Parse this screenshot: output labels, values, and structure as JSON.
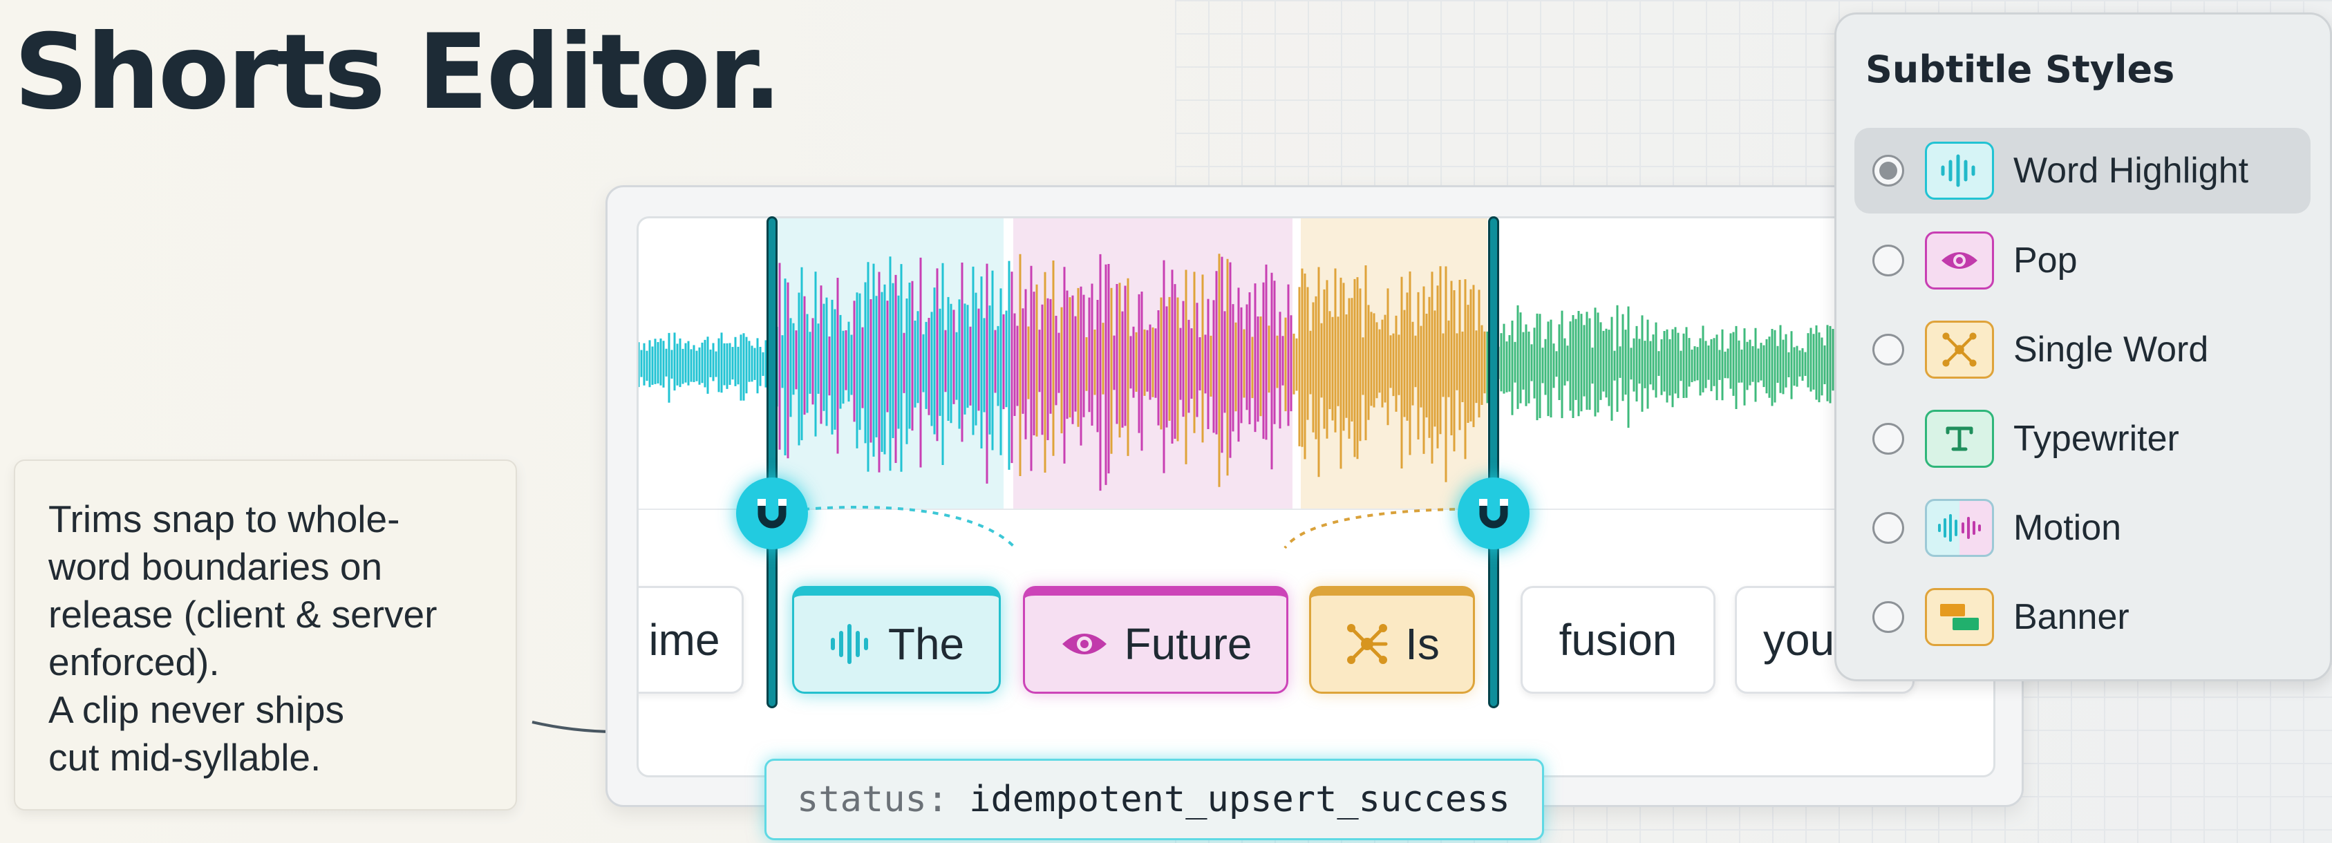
{
  "title": "Shorts Editor.",
  "note": {
    "text": "Trims snap to whole-\nword boundaries on\nrelease (client & server\nenforced).\nA clip never ships\ncut mid-syllable."
  },
  "timeline": {
    "chips": [
      {
        "label": "ime",
        "style": "plain",
        "icon": "none"
      },
      {
        "label": "The",
        "style": "cyan",
        "icon": "waveform-icon"
      },
      {
        "label": "Future",
        "style": "pink",
        "icon": "eye-icon"
      },
      {
        "label": "Is",
        "style": "gold",
        "icon": "burst-icon"
      },
      {
        "label": "fusion",
        "style": "plain",
        "icon": "none"
      },
      {
        "label": "you",
        "style": "plain",
        "icon": "none"
      }
    ],
    "handles": [
      {
        "icon": "magnet-icon"
      },
      {
        "icon": "magnet-icon"
      }
    ]
  },
  "status": {
    "key": "status:",
    "value": "idempotent_upsert_success"
  },
  "panel": {
    "title": "Subtitle Styles",
    "options": [
      {
        "label": "Word Highlight",
        "selected": true,
        "icon": "waveform-icon",
        "color": "#22c3d3"
      },
      {
        "label": "Pop",
        "selected": false,
        "icon": "eye-icon",
        "color": "#c83fb3"
      },
      {
        "label": "Single Word",
        "selected": false,
        "icon": "burst-icon",
        "color": "#dfa33a"
      },
      {
        "label": "Typewriter",
        "selected": false,
        "icon": "text-t-icon",
        "color": "#2fb67a"
      },
      {
        "label": "Motion",
        "selected": false,
        "icon": "motion-waveform-icon",
        "color": "#22c3d3"
      },
      {
        "label": "Banner",
        "selected": false,
        "icon": "banner-icon",
        "color": "#e59a1f"
      }
    ]
  },
  "colors": {
    "cyan": "#22c3d3",
    "pink": "#c83fb3",
    "gold": "#dfa33a",
    "green": "#3fba7c",
    "handle": "#0e8f9b"
  }
}
